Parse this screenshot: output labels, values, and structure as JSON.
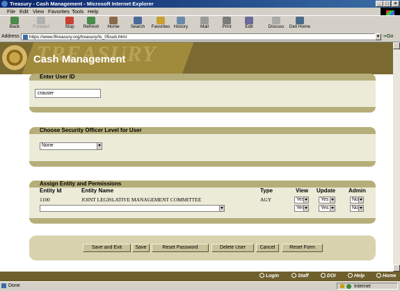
{
  "window": {
    "title": "Treasury - Cash Management - Microsoft Internet Explorer"
  },
  "menu": [
    "File",
    "Edit",
    "View",
    "Favorites",
    "Tools",
    "Help"
  ],
  "toolbar": [
    {
      "label": "Back",
      "icon": "back-arrow-icon",
      "enabled": true
    },
    {
      "label": "Forward",
      "icon": "forward-arrow-icon",
      "enabled": false
    },
    {
      "label": "Stop",
      "icon": "stop-icon",
      "enabled": true
    },
    {
      "label": "Refresh",
      "icon": "refresh-icon",
      "enabled": true
    },
    {
      "label": "Home",
      "icon": "home-icon",
      "enabled": true
    },
    {
      "label": "Search",
      "icon": "search-icon",
      "enabled": true
    },
    {
      "label": "Favorites",
      "icon": "favorites-icon",
      "enabled": true
    },
    {
      "label": "History",
      "icon": "history-icon",
      "enabled": true
    },
    {
      "label": "Mail",
      "icon": "mail-icon",
      "enabled": true
    },
    {
      "label": "Print",
      "icon": "print-icon",
      "enabled": true
    },
    {
      "label": "Edit",
      "icon": "edit-icon",
      "enabled": true
    },
    {
      "label": "Discuss",
      "icon": "discuss-icon",
      "enabled": true
    },
    {
      "label": "Dell Home",
      "icon": "dell-home-icon",
      "enabled": true
    }
  ],
  "address": {
    "label": "Address",
    "url": "https://www.fltreasury.org/treasury/ts_05sub.html",
    "go": "Go"
  },
  "header": {
    "watermark": "TREASURY",
    "title": "Cash Management"
  },
  "user_section": {
    "title": "Enter User ID",
    "user_id": "crauser"
  },
  "security_section": {
    "title": "Choose Security Officer Level for User",
    "level": "None"
  },
  "entity_section": {
    "title": "Assign Entity and Permissions",
    "headers": {
      "entity_id": "Entity Id",
      "entity_name": "Entity Name",
      "type": "Type",
      "view": "View",
      "update": "Update",
      "admin": "Admin"
    },
    "rows": [
      {
        "entity_id": "1100",
        "entity_name": "JOINT LEGISLATIVE MANAGEMENT COMMITTEE",
        "type": "AGY",
        "view": "Yes",
        "update": "Yes",
        "admin": "No"
      },
      {
        "entity_id": "",
        "entity_name": "",
        "type": "",
        "view": "Yes",
        "update": "Yes",
        "admin": "No"
      }
    ]
  },
  "buttons": [
    "Save and Exit",
    "Save",
    "Reset Password",
    "Delete User",
    "Cancel",
    "Reset Form"
  ],
  "footer_links": [
    "Login",
    "Staff",
    "DOI",
    "Help",
    "Home"
  ],
  "status": {
    "text": "Done",
    "zone": "Internet"
  },
  "colors": {
    "title_bar": "#0a246a",
    "header_brown": "#7a6a32",
    "panel_bg": "#ecebd7",
    "panel_band": "#b5ae7a"
  }
}
